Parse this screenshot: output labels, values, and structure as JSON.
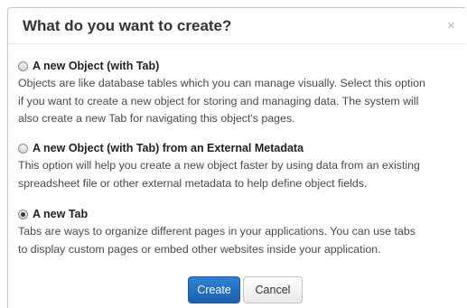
{
  "dialog": {
    "title": "What do you want to create?",
    "close_symbol": "×"
  },
  "options": [
    {
      "label": "A new Object (with Tab)",
      "selected": false,
      "description": [
        "Objects are like database tables which you can manage visually. Select this option",
        "if you want to create a new object for storing and managing data. The system will",
        "also create a new Tab for navigating this object's pages."
      ]
    },
    {
      "label": "A new Object (with Tab) from an External Metadata",
      "selected": false,
      "description": [
        "This option will help you create a new object faster by using data from an existing",
        "spreadsheet file or other external metadata to help define object fields."
      ]
    },
    {
      "label": "A new Tab",
      "selected": true,
      "description": [
        "Tabs are ways to organize different pages in your applications. You can use tabs",
        "to display custom pages or embed other websites inside your application."
      ]
    }
  ],
  "buttons": {
    "create": "Create",
    "cancel": "Cancel"
  },
  "colors": {
    "primary_button": "#1b6ec2",
    "title_text": "#333333",
    "body_text": "#4a4a4a"
  }
}
